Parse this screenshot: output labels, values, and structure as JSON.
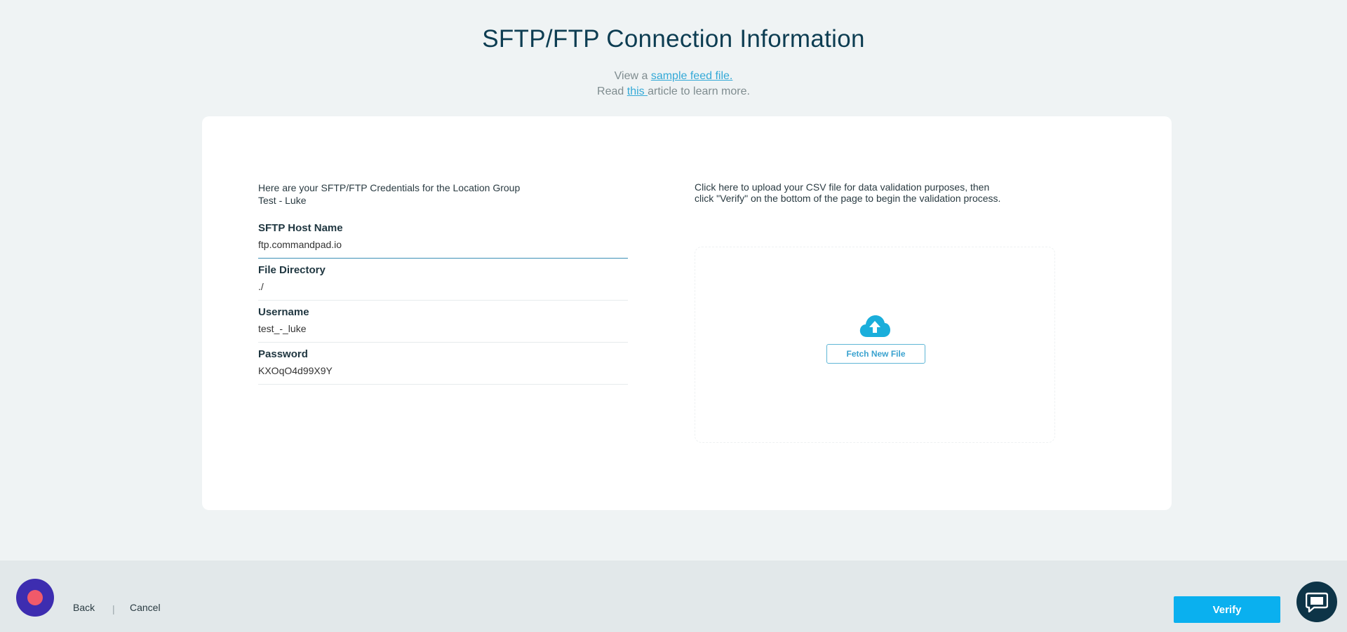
{
  "header": {
    "title": "SFTP/FTP Connection Information",
    "line1_prefix": "View a ",
    "line1_link": "sample feed file.",
    "line2_prefix": "Read ",
    "line2_link": "this ",
    "line2_suffix": "article to learn more."
  },
  "credentials": {
    "intro_line1": "Here are your SFTP/FTP Credentials for the Location Group",
    "intro_line2": "Test - Luke",
    "fields": [
      {
        "label": "SFTP Host Name",
        "value": "ftp.commandpad.io"
      },
      {
        "label": "File Directory",
        "value": "./"
      },
      {
        "label": "Username",
        "value": "test_-_luke"
      },
      {
        "label": "Password",
        "value": "KXOqO4d99X9Y"
      }
    ]
  },
  "upload": {
    "intro_line1": "Click here to upload your CSV file for data validation purposes, then",
    "intro_line2": "click \"Verify\" on the bottom of the page to begin the validation process.",
    "fetch_label": "Fetch New File",
    "icon": "cloud-upload-icon"
  },
  "footer": {
    "back_label": "Back",
    "separator": "|",
    "cancel_label": "Cancel",
    "verify_label": "Verify"
  },
  "colors": {
    "accent": "#0ab0ef",
    "title": "#0d3d52",
    "link": "#33a9d7",
    "brand": "#3d2db0"
  }
}
